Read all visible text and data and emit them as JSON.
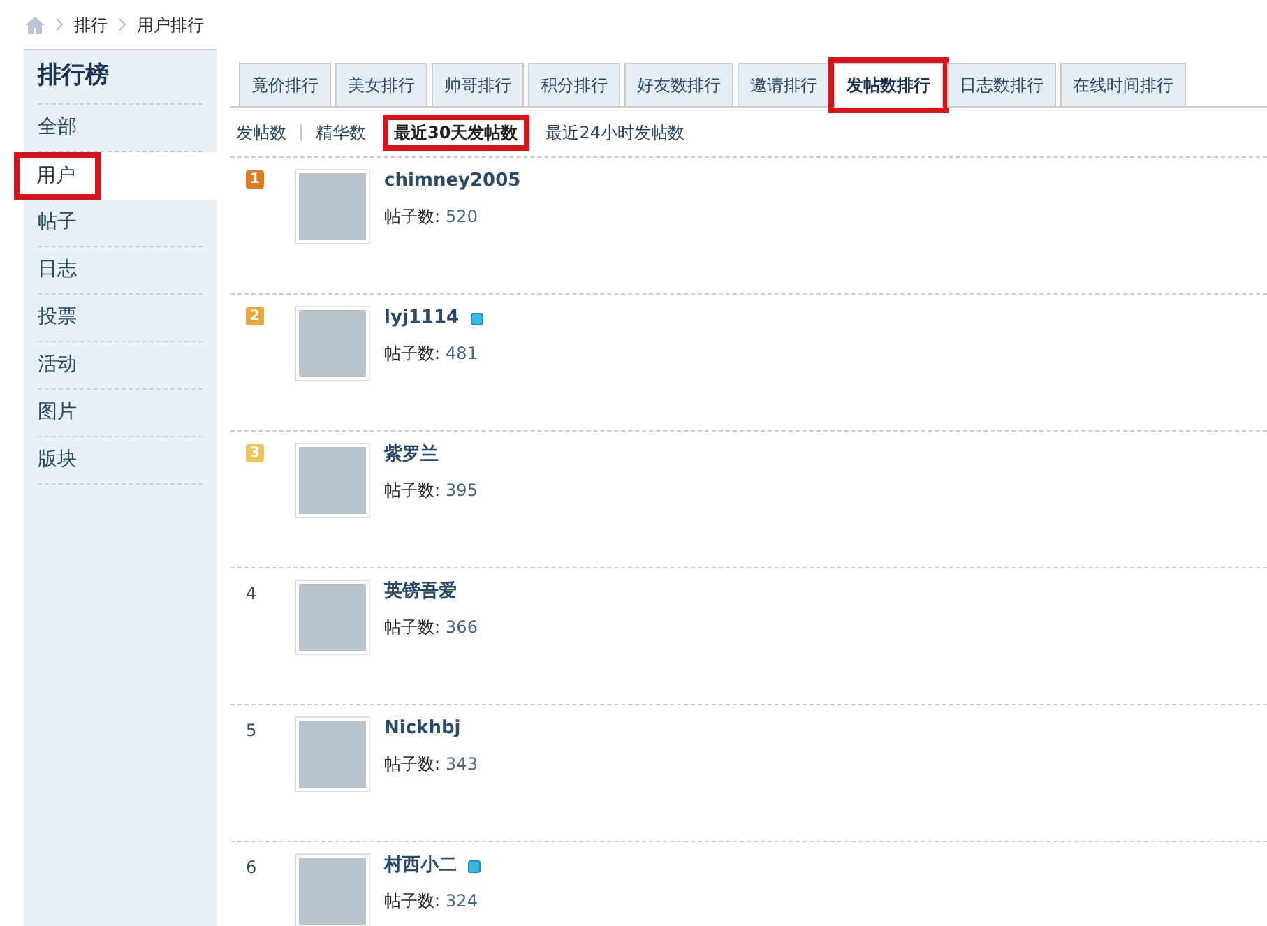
{
  "breadcrumb": [
    "排行",
    "用户排行"
  ],
  "sidebar": {
    "title": "排行榜",
    "items": [
      {
        "label": "全部",
        "selected": false,
        "highlighted": false
      },
      {
        "label": "用户",
        "selected": true,
        "highlighted": true
      },
      {
        "label": "帖子",
        "selected": false,
        "highlighted": false
      },
      {
        "label": "日志",
        "selected": false,
        "highlighted": false
      },
      {
        "label": "投票",
        "selected": false,
        "highlighted": false
      },
      {
        "label": "活动",
        "selected": false,
        "highlighted": false
      },
      {
        "label": "图片",
        "selected": false,
        "highlighted": false
      },
      {
        "label": "版块",
        "selected": false,
        "highlighted": false
      }
    ]
  },
  "tabs": [
    {
      "label": "竟价排行",
      "selected": false,
      "highlighted": false
    },
    {
      "label": "美女排行",
      "selected": false,
      "highlighted": false
    },
    {
      "label": "帅哥排行",
      "selected": false,
      "highlighted": false
    },
    {
      "label": "积分排行",
      "selected": false,
      "highlighted": false
    },
    {
      "label": "好友数排行",
      "selected": false,
      "highlighted": false
    },
    {
      "label": "邀请排行",
      "selected": false,
      "highlighted": false
    },
    {
      "label": "发帖数排行",
      "selected": true,
      "highlighted": true
    },
    {
      "label": "日志数排行",
      "selected": false,
      "highlighted": false
    },
    {
      "label": "在线时间排行",
      "selected": false,
      "highlighted": false
    }
  ],
  "subtabs": [
    {
      "label": "发帖数",
      "selected": false,
      "highlighted": false
    },
    {
      "label": "精华数",
      "selected": false,
      "highlighted": false
    },
    {
      "label": "最近30天发帖数",
      "selected": true,
      "highlighted": true
    },
    {
      "label": "最近24小时发帖数",
      "selected": false,
      "highlighted": false
    }
  ],
  "users": [
    {
      "rank": "1",
      "kind": "badge",
      "color": "#e07a1f",
      "name": "chimney2005",
      "online": false,
      "count_label": "帖子数:",
      "count": "520"
    },
    {
      "rank": "2",
      "kind": "badge",
      "color": "#e8a838",
      "name": "lyj1114",
      "online": true,
      "count_label": "帖子数:",
      "count": "481"
    },
    {
      "rank": "3",
      "kind": "badge",
      "color": "#f0c45c",
      "name": "紫罗兰",
      "online": false,
      "count_label": "帖子数:",
      "count": "395"
    },
    {
      "rank": "4",
      "kind": "plain",
      "color": "#2b4a66",
      "name": "英镑吾爱",
      "online": false,
      "count_label": "帖子数:",
      "count": "366"
    },
    {
      "rank": "5",
      "kind": "plain",
      "color": "#2b4a66",
      "name": "Nickhbj",
      "online": false,
      "count_label": "帖子数:",
      "count": "343"
    },
    {
      "rank": "6",
      "kind": "plain",
      "color": "#2b4a66",
      "name": "村西小二",
      "online": true,
      "count_label": "帖子数:",
      "count": "324"
    }
  ]
}
